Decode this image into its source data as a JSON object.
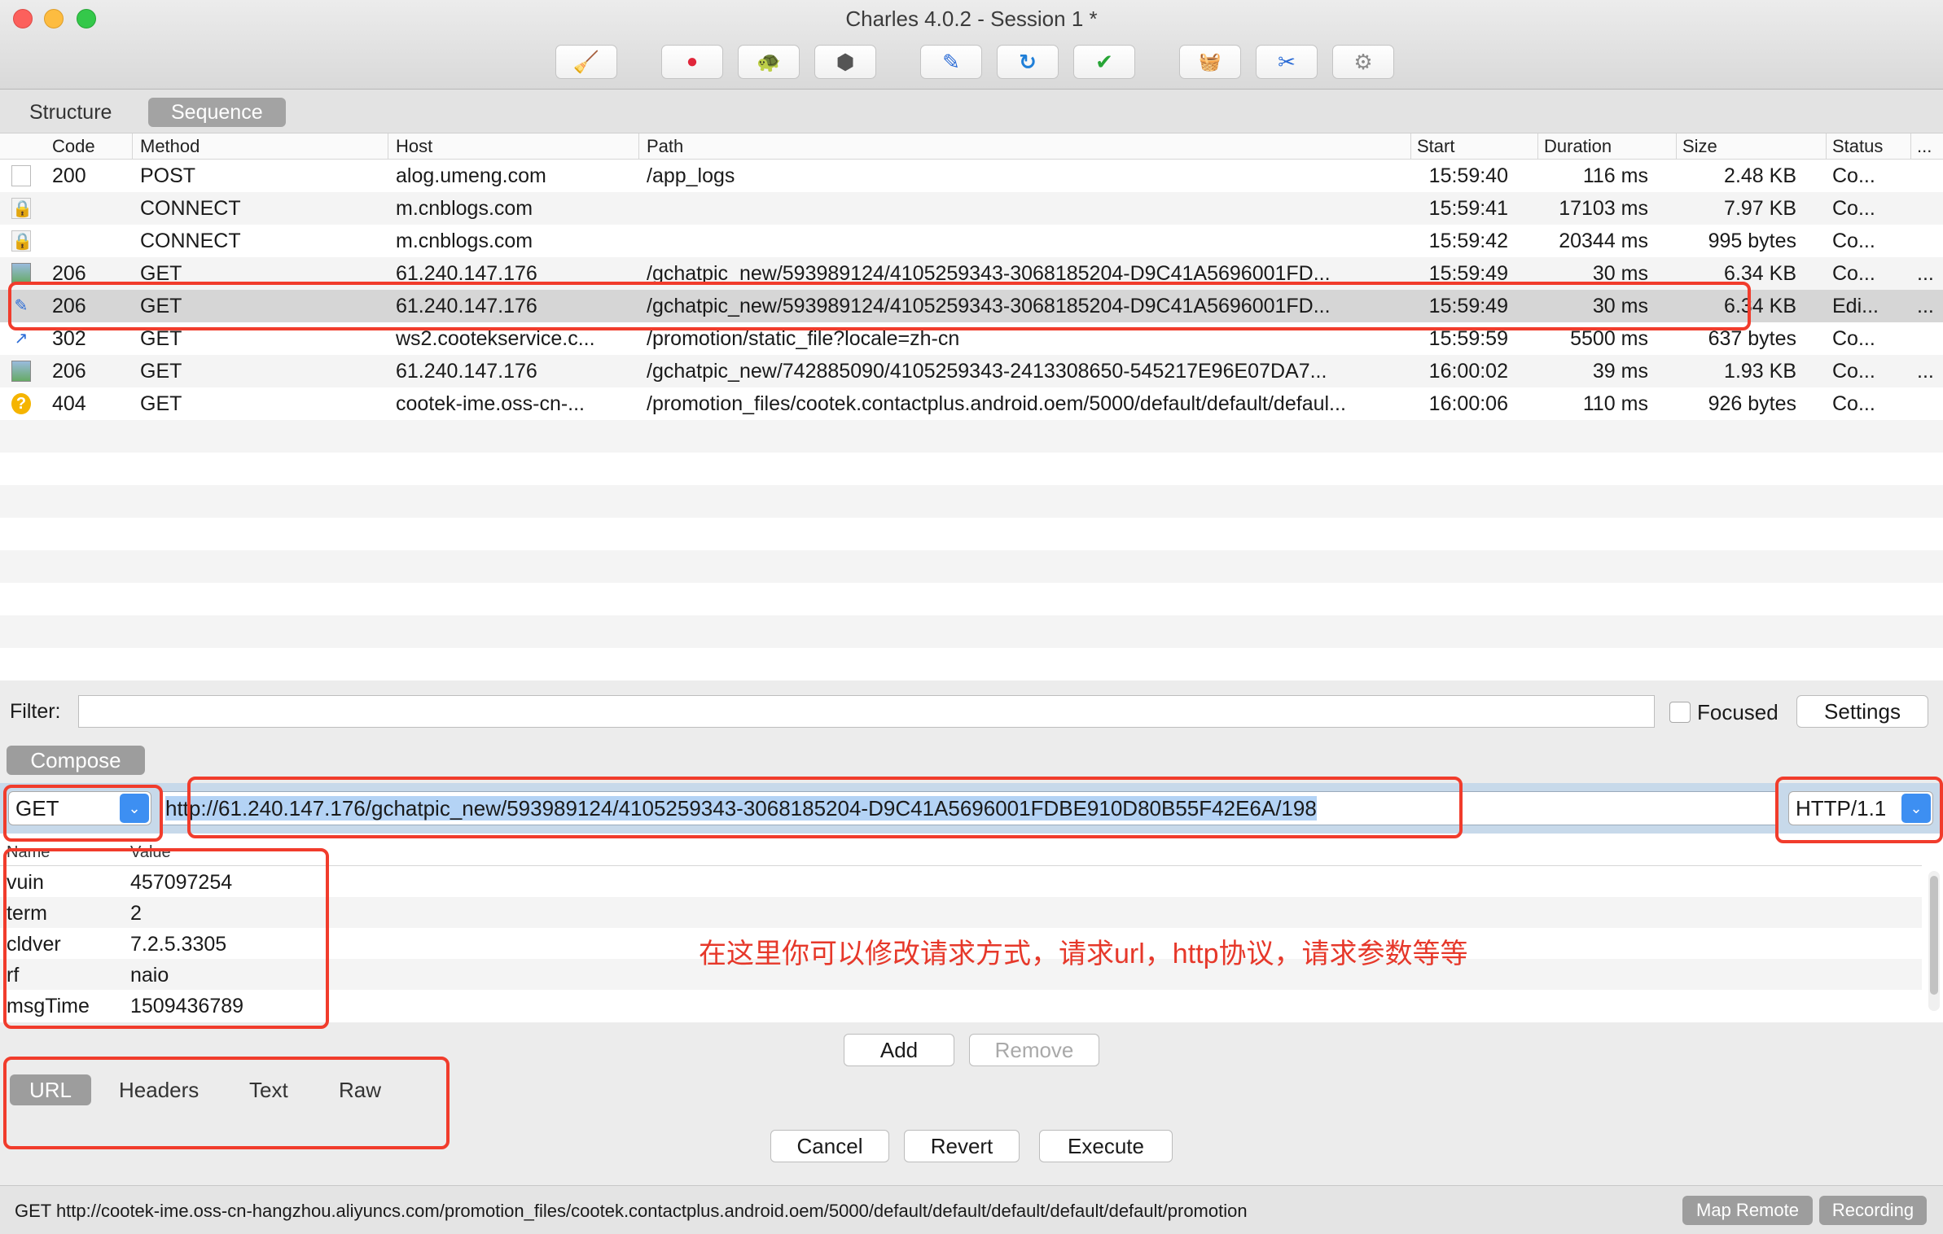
{
  "window": {
    "title": "Charles 4.0.2 - Session 1 *"
  },
  "toolbar": {
    "buttons": [
      {
        "icon": "broom-icon",
        "glyph": "🧹"
      },
      {
        "icon": "record-icon",
        "glyph": "●"
      },
      {
        "icon": "turtle-throttle-icon",
        "glyph": "🐢"
      },
      {
        "icon": "stop-breakpoints-icon",
        "glyph": "⬢"
      },
      {
        "icon": "compose-pencil-icon",
        "glyph": "✎"
      },
      {
        "icon": "repeat-icon",
        "glyph": "↻"
      },
      {
        "icon": "validate-check-icon",
        "glyph": "✔"
      },
      {
        "icon": "basket-icon",
        "glyph": "🧺"
      },
      {
        "icon": "tools-icon",
        "glyph": "✂"
      },
      {
        "icon": "settings-gear-icon",
        "glyph": "⚙"
      }
    ]
  },
  "view_tabs": {
    "structure": "Structure",
    "sequence": "Sequence"
  },
  "table": {
    "columns": {
      "code": "Code",
      "method": "Method",
      "host": "Host",
      "path": "Path",
      "start": "Start",
      "duration": "Duration",
      "size": "Size",
      "status": "Status",
      "more": "..."
    },
    "rows": [
      {
        "icon": "document-icon",
        "code": "200",
        "method": "POST",
        "host": "alog.umeng.com",
        "path": "/app_logs",
        "start": "15:59:40",
        "duration": "116 ms",
        "size": "2.48 KB",
        "status": "Co...",
        "more": ""
      },
      {
        "icon": "lock-icon",
        "code": "",
        "method": "CONNECT",
        "host": "m.cnblogs.com",
        "path": "",
        "start": "15:59:41",
        "duration": "17103 ms",
        "size": "7.97 KB",
        "status": "Co...",
        "more": ""
      },
      {
        "icon": "lock-icon",
        "code": "",
        "method": "CONNECT",
        "host": "m.cnblogs.com",
        "path": "",
        "start": "15:59:42",
        "duration": "20344 ms",
        "size": "995 bytes",
        "status": "Co...",
        "more": ""
      },
      {
        "icon": "image-icon",
        "code": "206",
        "method": "GET",
        "host": "61.240.147.176",
        "path": "/gchatpic_new/593989124/4105259343-3068185204-D9C41A5696001FD...",
        "start": "15:59:49",
        "duration": "30 ms",
        "size": "6.34 KB",
        "status": "Co...",
        "more": "..."
      },
      {
        "icon": "pencil-icon",
        "code": "206",
        "method": "GET",
        "host": "61.240.147.176",
        "path": "/gchatpic_new/593989124/4105259343-3068185204-D9C41A5696001FD...",
        "start": "15:59:49",
        "duration": "30 ms",
        "size": "6.34 KB",
        "status": "Edi...",
        "more": "..."
      },
      {
        "icon": "redirect-arrow-icon",
        "code": "302",
        "method": "GET",
        "host": "ws2.cootekservice.c...",
        "path": "/promotion/static_file?locale=zh-cn",
        "start": "15:59:59",
        "duration": "5500 ms",
        "size": "637 bytes",
        "status": "Co...",
        "more": ""
      },
      {
        "icon": "image-icon",
        "code": "206",
        "method": "GET",
        "host": "61.240.147.176",
        "path": "/gchatpic_new/742885090/4105259343-2413308650-545217E96E07DA7...",
        "start": "16:00:02",
        "duration": "39 ms",
        "size": "1.93 KB",
        "status": "Co...",
        "more": "..."
      },
      {
        "icon": "question-icon",
        "code": "404",
        "method": "GET",
        "host": "cootek-ime.oss-cn-...",
        "path": "/promotion_files/cootek.contactplus.android.oem/5000/default/default/defaul...",
        "start": "16:00:06",
        "duration": "110 ms",
        "size": "926 bytes",
        "status": "Co...",
        "more": ""
      }
    ]
  },
  "filter": {
    "label": "Filter:",
    "value": "",
    "focused_label": "Focused",
    "settings_label": "Settings"
  },
  "compose": {
    "tab_label": "Compose",
    "method": "GET",
    "url": "http://61.240.147.176/gchatpic_new/593989124/4105259343-3068185204-D9C41A5696001FDBE910D80B55F42E6A/198",
    "protocol": "HTTP/1.1",
    "params_header": {
      "name": "Name",
      "value": "Value"
    },
    "params": [
      {
        "name": "vuin",
        "value": "457097254"
      },
      {
        "name": "term",
        "value": "2"
      },
      {
        "name": "cldver",
        "value": "7.2.5.3305"
      },
      {
        "name": "rf",
        "value": "naio"
      },
      {
        "name": "msgTime",
        "value": "1509436789"
      }
    ],
    "annotation": "在这里你可以修改请求方式，请求url，http协议，请求参数等等",
    "add_label": "Add",
    "remove_label": "Remove",
    "tabs": {
      "url": "URL",
      "headers": "Headers",
      "text": "Text",
      "raw": "Raw"
    },
    "cancel_label": "Cancel",
    "revert_label": "Revert",
    "execute_label": "Execute"
  },
  "statusbar": {
    "text": "GET http://cootek-ime.oss-cn-hangzhou.aliyuncs.com/promotion_files/cootek.contactplus.android.oem/5000/default/default/default/default/default/promotion",
    "map_remote": "Map Remote",
    "recording": "Recording"
  },
  "colors": {
    "highlight": "#f13c2c",
    "annotation": "#e6382a",
    "accent": "#3d8ff2"
  }
}
